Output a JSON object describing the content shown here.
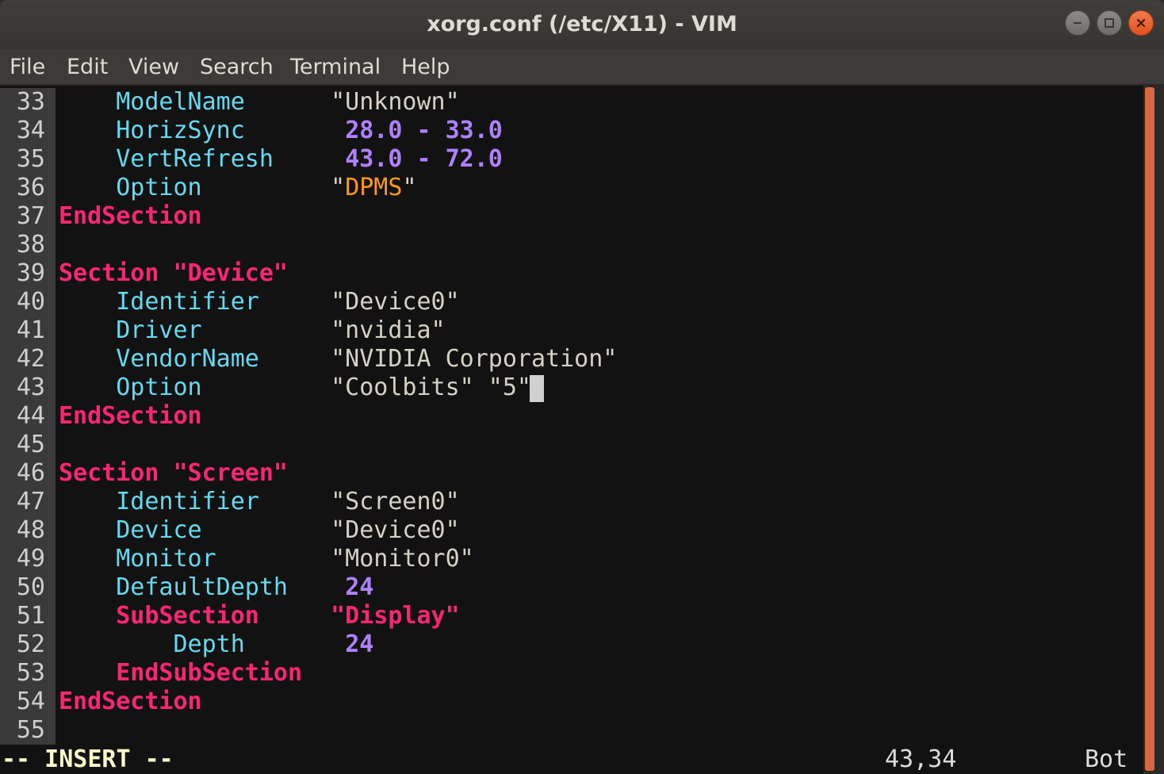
{
  "window": {
    "title": "xorg.conf (/etc/X11) - VIM"
  },
  "menu": [
    "File",
    "Edit",
    "View",
    "Search",
    "Terminal",
    "Help"
  ],
  "editor": {
    "lines": [
      {
        "n": "33",
        "ind": 1,
        "key": "ModelName",
        "keyClass": "id",
        "val": "\"Unknown\"",
        "valClass": "strv"
      },
      {
        "n": "34",
        "ind": 1,
        "key": "HorizSync",
        "keyClass": "id",
        "val": "28.0 - 33.0",
        "valClass": "num",
        "valOffset": 1
      },
      {
        "n": "35",
        "ind": 1,
        "key": "VertRefresh",
        "keyClass": "id",
        "val": "43.0 - 72.0",
        "valClass": "num",
        "valOffset": 1
      },
      {
        "n": "36",
        "ind": 1,
        "key": "Option",
        "keyClass": "id",
        "val": "\"DPMS\"",
        "valClass": "dpms"
      },
      {
        "n": "37",
        "ind": 0,
        "key": "EndSection",
        "keyClass": "kw"
      },
      {
        "n": "38"
      },
      {
        "n": "39",
        "ind": 0,
        "key": "Section \"Device\"",
        "keyClass": "kw"
      },
      {
        "n": "40",
        "ind": 1,
        "key": "Identifier",
        "keyClass": "id",
        "val": "\"Device0\"",
        "valClass": "strv"
      },
      {
        "n": "41",
        "ind": 1,
        "key": "Driver",
        "keyClass": "id",
        "val": "\"nvidia\"",
        "valClass": "strv"
      },
      {
        "n": "42",
        "ind": 1,
        "key": "VendorName",
        "keyClass": "id",
        "val": "\"NVIDIA Corporation\"",
        "valClass": "strv"
      },
      {
        "n": "43",
        "ind": 1,
        "key": "Option",
        "keyClass": "id",
        "val": "\"Coolbits\" \"5\"",
        "valClass": "strv"
      },
      {
        "n": "44",
        "ind": 0,
        "key": "EndSection",
        "keyClass": "kw"
      },
      {
        "n": "45"
      },
      {
        "n": "46",
        "ind": 0,
        "key": "Section \"Screen\"",
        "keyClass": "kw"
      },
      {
        "n": "47",
        "ind": 1,
        "key": "Identifier",
        "keyClass": "id",
        "val": "\"Screen0\"",
        "valClass": "strv"
      },
      {
        "n": "48",
        "ind": 1,
        "key": "Device",
        "keyClass": "id",
        "val": "\"Device0\"",
        "valClass": "strv"
      },
      {
        "n": "49",
        "ind": 1,
        "key": "Monitor",
        "keyClass": "id",
        "val": "\"Monitor0\"",
        "valClass": "strv"
      },
      {
        "n": "50",
        "ind": 1,
        "key": "DefaultDepth",
        "keyClass": "id",
        "val": "24",
        "valClass": "num",
        "valOffset": 1
      },
      {
        "n": "51",
        "ind": 1,
        "key": "SubSection",
        "keyClass": "kw",
        "val": "\"Display\"",
        "valClass": "kw"
      },
      {
        "n": "52",
        "ind": 2,
        "key": "Depth",
        "keyClass": "id",
        "val": "24",
        "valClass": "num",
        "valOffset": 1
      },
      {
        "n": "53",
        "ind": 1,
        "key": "EndSubSection",
        "keyClass": "kw"
      },
      {
        "n": "54",
        "ind": 0,
        "key": "EndSection",
        "keyClass": "kw"
      },
      {
        "n": "55"
      }
    ]
  },
  "status": {
    "mode": "-- INSERT --",
    "position": "43,34",
    "scroll": "Bot"
  }
}
